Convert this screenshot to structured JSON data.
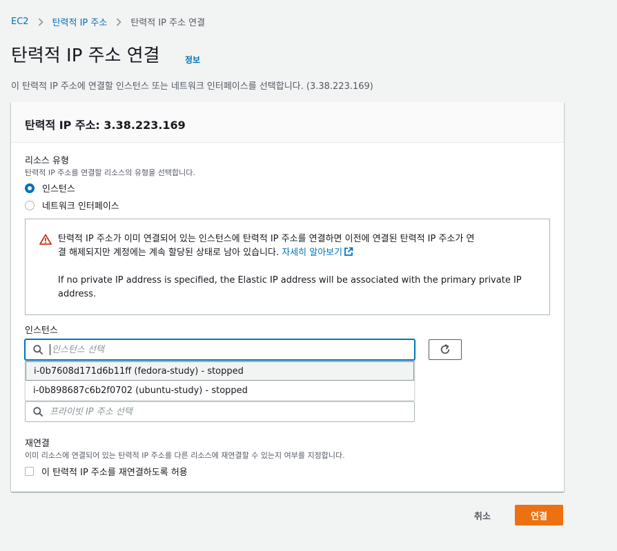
{
  "breadcrumb": {
    "items": [
      {
        "label": "EC2"
      },
      {
        "label": "탄력적 IP 주소"
      },
      {
        "label": "탄력적 IP 주소 연결"
      }
    ]
  },
  "page": {
    "title": "탄력적 IP 주소 연결",
    "info_link": "정보",
    "description": "이 탄력적 IP 주소에 연결할 인스턴스 또는 네트워크 인터페이스를 선택합니다. (3.38.223.169)"
  },
  "panel": {
    "title": "탄력적 IP 주소: 3.38.223.169"
  },
  "resource_type": {
    "label": "리소스 유형",
    "description": "탄력적 IP 주소를 연결할 리소스의 유형을 선택합니다.",
    "options": [
      {
        "label": "인스턴스",
        "checked": true
      },
      {
        "label": "네트워크 인터페이스",
        "checked": false
      }
    ]
  },
  "alert": {
    "line1": "탄력적 IP 주소가 이미 연결되어 있는 인스턴스에 탄력적 IP 주소를 연결하면 이전에 연결된 탄력적 IP 주소가 연",
    "line2": "결 해제되지만 계정에는 계속 할당된 상태로 남아 있습니다. ",
    "link": "자세히 알아보기",
    "note": "If no private IP address is specified, the Elastic IP address will be associated with the primary private IP address."
  },
  "instance": {
    "label": "인스턴스",
    "placeholder": "인스턴스 선택",
    "options": [
      "i-0b7608d171d6b11ff (fedora-study) - stopped",
      "i-0b898687c6b2f0702 (ubuntu-study) - stopped"
    ]
  },
  "private_ip": {
    "placeholder": "프라이빗 IP 주소 선택"
  },
  "reassociation": {
    "label": "재연결",
    "description": "이미 리소스에 연결되어 있는 탄력적 IP 주소를 다른 리소스에 재연결할 수 있는지 여부를 지정합니다.",
    "checkbox_label": "이 탄력적 IP 주소를 재연결하도록 허용",
    "checked": false
  },
  "actions": {
    "cancel": "취소",
    "connect": "연결"
  },
  "colors": {
    "link": "#0073bb",
    "primary_button": "#ec7211",
    "warning": "#d13212"
  }
}
